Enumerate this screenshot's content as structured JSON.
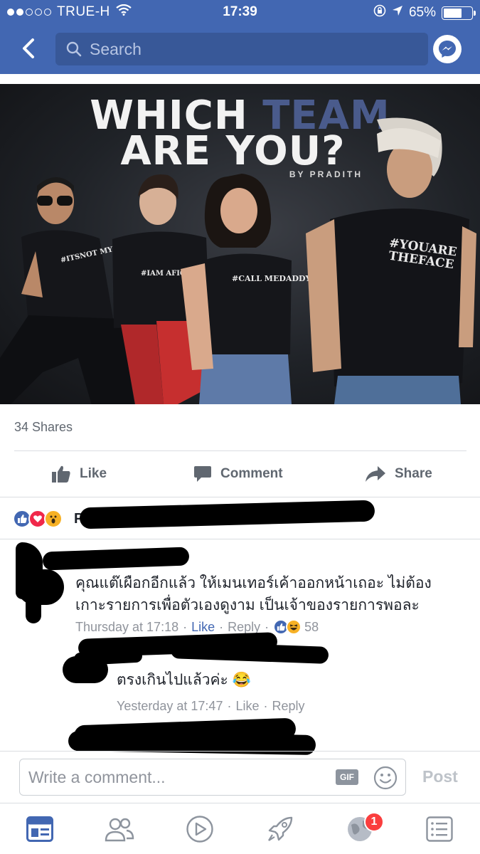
{
  "status_bar": {
    "carrier": "TRUE-H",
    "time": "17:39",
    "battery": "65%",
    "battery_level": 0.65
  },
  "nav": {
    "search_placeholder": "Search",
    "back_icon": "chevron-left-icon",
    "messenger_icon": "messenger-icon"
  },
  "post": {
    "image": {
      "headline_line1_a": "WHICH",
      "headline_line1_b": "TEAM",
      "headline_line2": "ARE YOU?",
      "byline": "BY PRADITH",
      "shirts": [
        "#ITSNOT MYPROBLEM",
        "#IAM AFIGHTER",
        "#CALL MEDADDY",
        "#YOUARE THEFACE"
      ]
    },
    "shares": "34 Shares",
    "actions": {
      "like": "Like",
      "comment": "Comment",
      "share": "Share"
    },
    "reactions_visible_name": "P",
    "colors": {
      "brand": "#4267b2",
      "like_blue": "#4267b2",
      "love_red": "#f0284a",
      "wow_yellow": "#f7b125"
    }
  },
  "comments": [
    {
      "text_line1": "คุณแต๊เผือกอีกแล้ว ให้เมนเทอร์เค้าออกหน้าเถอะ ไม่ต้อง",
      "text_line2": "เกาะรายการเพื่อตัวเองดูงาม เป็นเจ้าของรายการพอละ",
      "time": "Thursday at 17:18",
      "like": "Like",
      "reply": "Reply",
      "reaction_count": "58"
    },
    {
      "text": "ตรงเกินไปแล้วค่ะ 😂",
      "time": "Yesterday at 17:47",
      "like": "Like",
      "reply": "Reply"
    }
  ],
  "composer": {
    "placeholder": "Write a comment...",
    "gif": "GIF",
    "post": "Post"
  },
  "tabbar": {
    "tabs": [
      "news-feed-icon",
      "friends-icon",
      "video-icon",
      "explore-rocket-icon",
      "globe-notifications-icon",
      "menu-icon"
    ],
    "badge": "1"
  }
}
